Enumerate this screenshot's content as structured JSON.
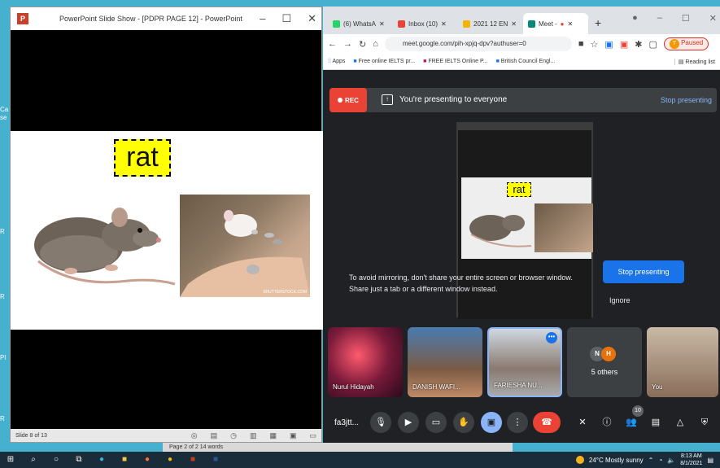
{
  "ppt": {
    "title": "PowerPoint Slide Show - [PDPR PAGE 12] - PowerPoint",
    "logo": "P",
    "controls": [
      "–",
      "☐",
      "✕"
    ],
    "slide_word": "rat",
    "photo_caption": "SHUTTERSTOCK.COM",
    "status": "Slide 8 of 13"
  },
  "desktop_edge": [
    "Ca",
    "se",
    "R",
    "R",
    "Pl",
    "R"
  ],
  "chrome": {
    "tabs": [
      {
        "label": "(6) WhatsA",
        "icon_color": "#25d366"
      },
      {
        "label": "Inbox (10)",
        "icon_color": "#ea4335"
      },
      {
        "label": "2021 12 EN",
        "icon_color": "#f4b400"
      },
      {
        "label": "Meet -",
        "icon_color": "#00897b"
      }
    ],
    "new_tab": "+",
    "window_controls": [
      "–",
      "☐",
      "✕"
    ],
    "url": "meet.google.com/pih-xpjq-dpv?authuser=0",
    "profile_initial": "T",
    "paused": "Paused",
    "bookmarks": [
      "Apps",
      "Free online IELTS pr...",
      "FREE IELTS Online P...",
      "British Council Engl..."
    ],
    "reading_list": "Reading list"
  },
  "meet": {
    "rec": "REC",
    "presenting_text": "You're presenting to everyone",
    "stop_link": "Stop presenting",
    "mini_word": "rat",
    "warning": "To avoid mirroring, don't share your entire screen or browser window. Share just a tab or a different window instead.",
    "stop_button": "Stop presenting",
    "ignore": "Ignore",
    "tiles": [
      {
        "name": "Nurul Hidayah"
      },
      {
        "name": "DANISH WAFI..."
      },
      {
        "name": "FARIESHA NU..."
      },
      {
        "name": "5 others",
        "initials": [
          "N",
          "H"
        ]
      },
      {
        "name": "You"
      }
    ],
    "meeting_code": "fa3jtt...",
    "participants_count": "10"
  },
  "taskbar": {
    "weather": "24°C  Mostly sunny",
    "time": "8:13 AM",
    "date": "8/1/2021"
  },
  "behind_doc": "Page 2 of 2    14 words"
}
